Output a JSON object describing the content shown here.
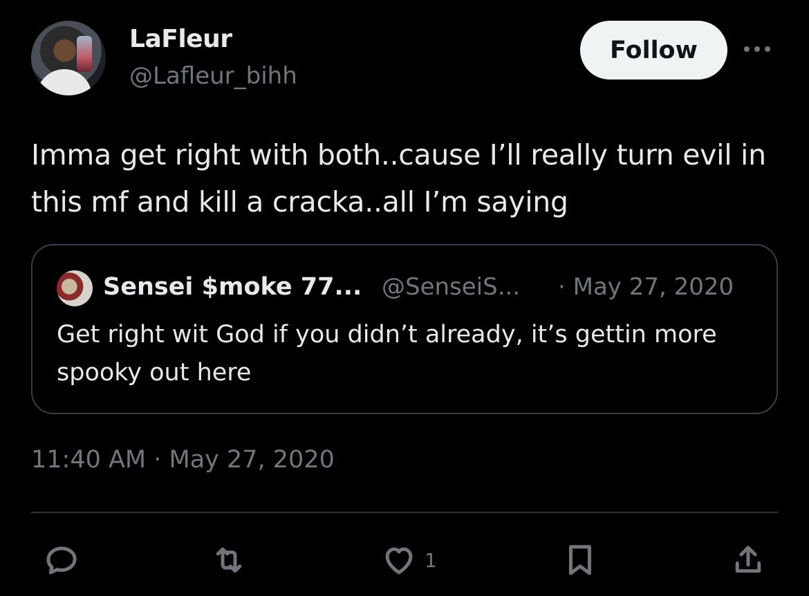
{
  "author": {
    "name": "LaFleur",
    "handle": "@Lafleur_bihh"
  },
  "header": {
    "follow_label": "Follow"
  },
  "tweet": {
    "text": "Imma get right with both..cause I’ll really turn evil in this mf and kill a cracka..all I’m saying",
    "timestamp": "11:40 AM · May 27, 2020"
  },
  "quoted": {
    "name": "Sensei $moke 77...",
    "handle": "@SenseiS...",
    "date": "· May 27, 2020",
    "text": "Get right wit God if you didn’t already, it’s gettin more spooky out here"
  },
  "actions": {
    "like_count": "1",
    "icons": [
      "reply-icon",
      "retweet-icon",
      "heart-icon",
      "bookmark-icon",
      "share-icon"
    ]
  },
  "colors": {
    "background": "#000000",
    "text": "#e7e9ea",
    "muted": "#71767b",
    "border": "#2f3336",
    "follow_bg": "#eff3f4"
  }
}
